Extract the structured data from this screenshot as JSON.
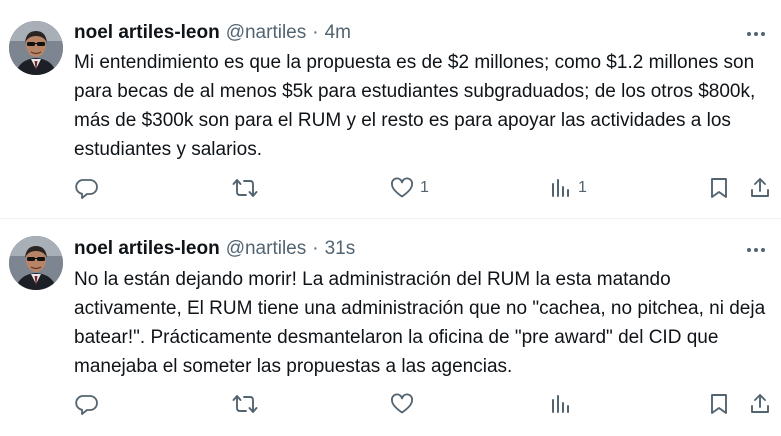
{
  "tweets": [
    {
      "author_name": "noel artiles-leon",
      "handle": "@nartiles",
      "separator": "·",
      "time": "4m",
      "text": "Mi entendimiento es que la propuesta es de $2 millones; como $1.2 millones son para becas de al menos $5k para estudiantes subgraduados; de los otros $800k, más de $300k son para el RUM y el resto es para apoyar las actividades a los estudiantes y salarios.",
      "likes": "1",
      "views": "1"
    },
    {
      "author_name": "noel artiles-leon",
      "handle": "@nartiles",
      "separator": "·",
      "time": "31s",
      "text": "No la están dejando morir! La administración del RUM la esta matando activamente, El RUM tiene una administración que no \"cachea, no pitchea, ni deja batear!\". Prácticamente desmantelaron la oficina de \"pre award\" del CID que manejaba el someter las propuestas a las agencias.",
      "likes": "",
      "views": ""
    }
  ],
  "icons": {
    "reply": "reply-icon",
    "repost": "repost-icon",
    "like": "heart-icon",
    "views": "views-icon",
    "bookmark": "bookmark-icon",
    "share": "share-icon",
    "more": "more-icon"
  },
  "colors": {
    "text": "#0f1419",
    "muted": "#536471",
    "divider": "#eff3f4"
  }
}
